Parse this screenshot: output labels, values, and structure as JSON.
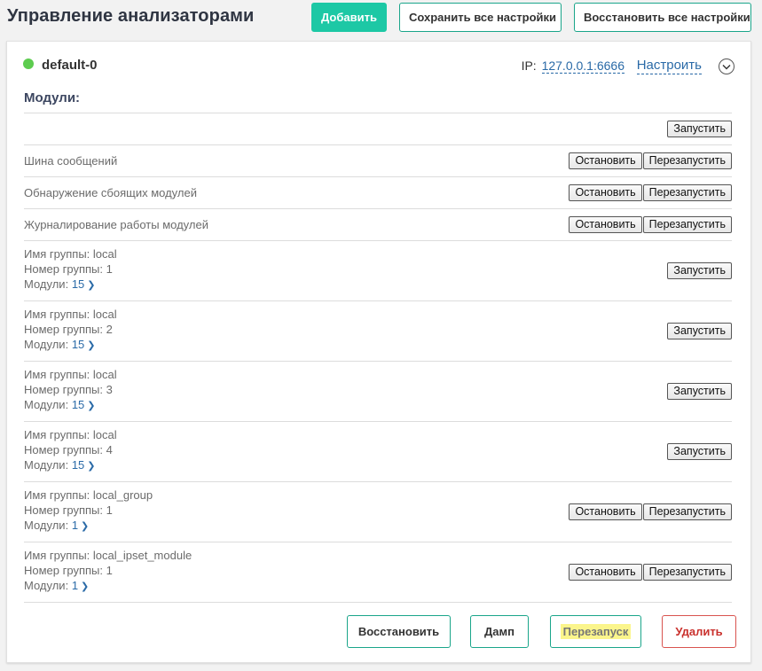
{
  "header": {
    "title": "Управление анализаторами",
    "add_label": "Добавить",
    "save_all_label": "Сохранить все настройки",
    "restore_all_label": "Восстановить все настройки"
  },
  "analyzer": {
    "name": "default-0",
    "status_color": "#5dcc4f",
    "ip_label": "IP:",
    "ip_value": "127.0.0.1:6666",
    "configure_label": "Настроить",
    "collapse_icon": "chevron-down-circle-icon"
  },
  "modules": {
    "title": "Модули:",
    "rows": [
      {
        "type": "single",
        "label": "",
        "actions": [
          "Запустить"
        ]
      },
      {
        "type": "single",
        "label": "Шина сообщений",
        "actions": [
          "Остановить",
          "Перезапустить"
        ]
      },
      {
        "type": "single",
        "label": "Обнаружение сбоящих модулей",
        "actions": [
          "Остановить",
          "Перезапустить"
        ]
      },
      {
        "type": "single",
        "label": "Журналирование работы модулей",
        "actions": [
          "Остановить",
          "Перезапустить"
        ]
      },
      {
        "type": "group",
        "name_label": "Имя группы: local",
        "number_label": "Номер группы: 1",
        "modules_label": "Модули:",
        "modules_count": "15",
        "actions": [
          "Запустить"
        ]
      },
      {
        "type": "group",
        "name_label": "Имя группы: local",
        "number_label": "Номер группы: 2",
        "modules_label": "Модули:",
        "modules_count": "15",
        "actions": [
          "Запустить"
        ]
      },
      {
        "type": "group",
        "name_label": "Имя группы: local",
        "number_label": "Номер группы: 3",
        "modules_label": "Модули:",
        "modules_count": "15",
        "actions": [
          "Запустить"
        ]
      },
      {
        "type": "group",
        "name_label": "Имя группы: local",
        "number_label": "Номер группы: 4",
        "modules_label": "Модули:",
        "modules_count": "15",
        "actions": [
          "Запустить"
        ]
      },
      {
        "type": "group",
        "name_label": "Имя группы: local_group",
        "number_label": "Номер группы: 1",
        "modules_label": "Модули:",
        "modules_count": "1",
        "actions": [
          "Остановить",
          "Перезапустить"
        ]
      },
      {
        "type": "group",
        "name_label": "Имя группы: local_ipset_module",
        "number_label": "Номер группы: 1",
        "modules_label": "Модули:",
        "modules_count": "1",
        "actions": [
          "Остановить",
          "Перезапустить"
        ]
      }
    ]
  },
  "footer": {
    "restore_label": "Восстановить",
    "dump_label": "Дамп",
    "restart_label": "Перезапуск",
    "delete_label": "Удалить"
  },
  "colors": {
    "accent": "#1dc8a5",
    "link": "#2a6aa7",
    "danger": "#d9534f",
    "highlight": "#fbf58c"
  }
}
